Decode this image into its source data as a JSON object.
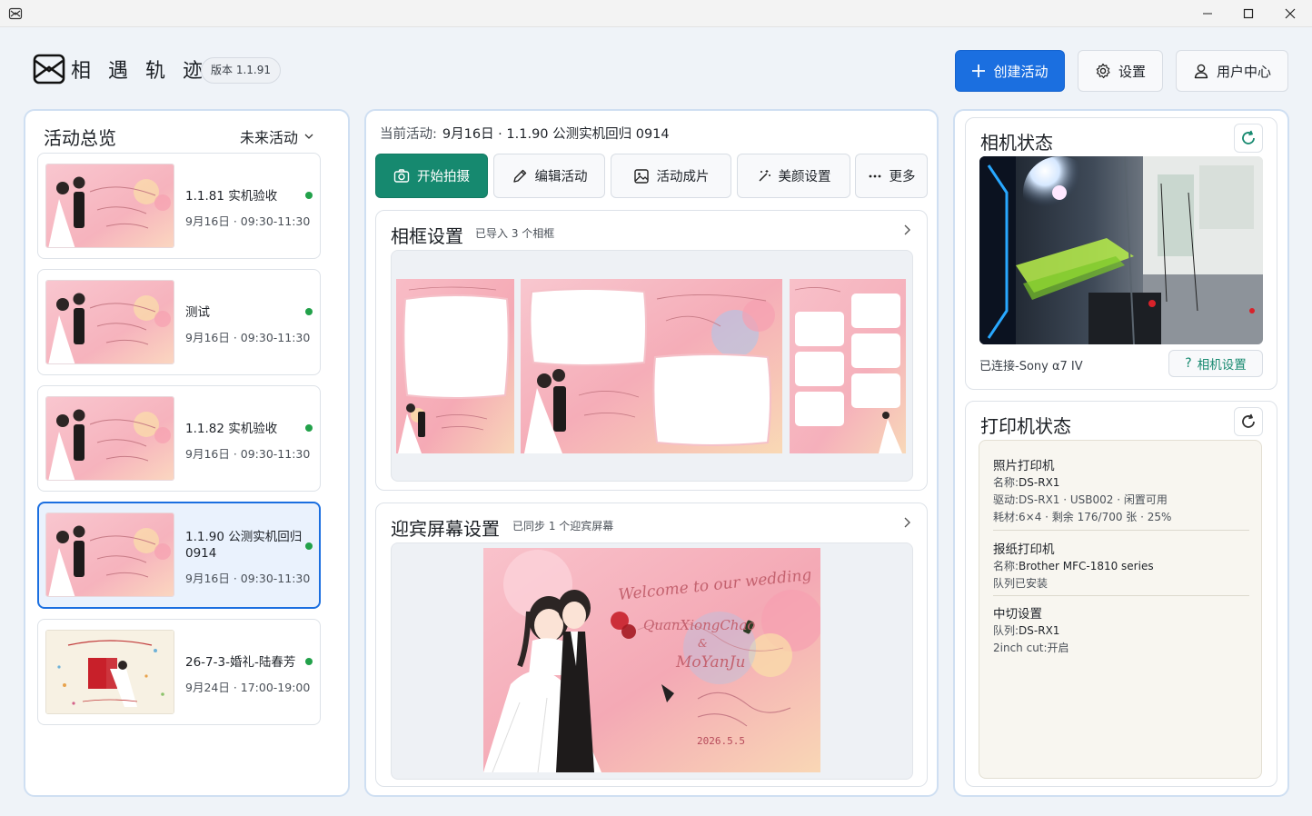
{
  "app": {
    "name": "相 遇 轨 迹",
    "version": "版本 1.1.91"
  },
  "header": {
    "create": "创建活动",
    "settings": "设置",
    "user": "用户中心"
  },
  "events": {
    "title": "活动总览",
    "filter": "未来活动",
    "items": [
      {
        "title": "1.1.81 实机验收",
        "time": "9月16日 · 09:30-11:30"
      },
      {
        "title": "测试",
        "time": "9月16日 · 09:30-11:30"
      },
      {
        "title": "1.1.82 实机验收",
        "time": "9月16日 · 09:30-11:30"
      },
      {
        "title": "1.1.90 公测实机回归 0914",
        "time": "9月16日 · 09:30-11:30"
      },
      {
        "title": "26-7-3-婚礼-陆春芳",
        "time": "9月24日 · 17:00-19:00"
      }
    ]
  },
  "current": {
    "label": "当前活动:",
    "value": "9月16日 · 1.1.90 公测实机回归 0914"
  },
  "toolbar": {
    "start": "开始拍摄",
    "edit": "编辑活动",
    "photos": "活动成片",
    "beauty": "美颜设置",
    "more": "更多"
  },
  "frames": {
    "title": "相框设置",
    "sub": "已导入 3 个相框"
  },
  "welcome": {
    "title": "迎宾屏幕设置",
    "sub": "已同步 1 个迎宾屏幕"
  },
  "camera": {
    "title": "相机状态",
    "status": "已连接-Sony α7 IV",
    "settings": "相机设置"
  },
  "printer": {
    "title": "打印机状态",
    "photo": {
      "heading": "照片打印机",
      "name_label": "名称:",
      "name": "DS-RX1",
      "driver": "驱动:DS-RX1 · USB002 · 闲置可用",
      "supply": "耗材:6×4 · 剩余 176/700 张 · 25%"
    },
    "report": {
      "heading": "报纸打印机",
      "name_label": "名称:",
      "name": "Brother MFC-1810 series",
      "queue": "队列已安装"
    },
    "cut": {
      "heading": "中切设置",
      "queue_label": "队列:",
      "queue": "DS-RX1",
      "mode": "2inch cut:开启"
    }
  },
  "artwork": {
    "welcome_line": "Welcome to our wedding",
    "groom": "QuanXiongChao",
    "amp": "&",
    "bride": "MoYanJu",
    "date": "2026.5.5"
  },
  "colors": {
    "primary": "#1b6fe0",
    "accent": "#16896f",
    "online": "#22a14a"
  }
}
